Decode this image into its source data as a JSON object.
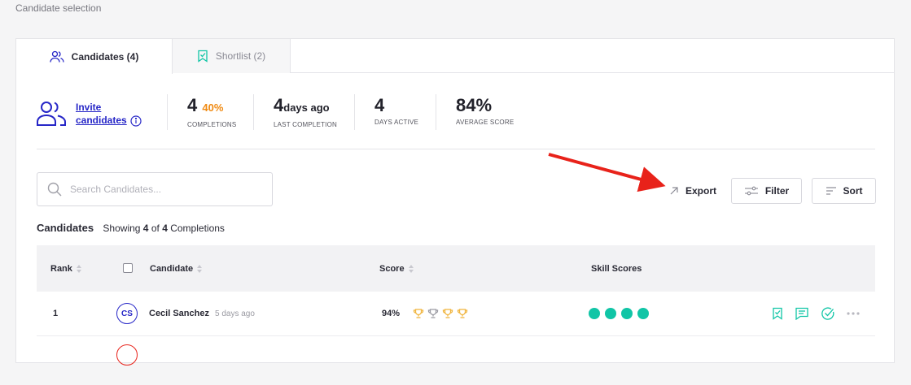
{
  "page": {
    "label": "Candidate selection"
  },
  "tabs": [
    {
      "label": "Candidates (4)",
      "icon": "users-icon",
      "active": true
    },
    {
      "label": "Shortlist (2)",
      "icon": "shortlist-icon",
      "active": false
    }
  ],
  "invite": {
    "label": "Invite candidates",
    "icon": "users-icon"
  },
  "stats": [
    {
      "value": "4",
      "suffix": "40%",
      "label": "COMPLETIONS"
    },
    {
      "value": "4",
      "suffix": "days ago",
      "label": "LAST COMPLETION"
    },
    {
      "value": "4",
      "suffix": "",
      "label": "DAYS ACTIVE"
    },
    {
      "value": "84%",
      "suffix": "",
      "label": "AVERAGE SCORE"
    }
  ],
  "search": {
    "placeholder": "Search Candidates...",
    "value": ""
  },
  "toolbar": {
    "export_label": "Export",
    "filter_label": "Filter",
    "sort_label": "Sort"
  },
  "summary": {
    "title": "Candidates",
    "showing_prefix": "Showing",
    "shown": "4",
    "of": "of",
    "total": "4",
    "suffix": "Completions"
  },
  "table": {
    "headers": {
      "rank": "Rank",
      "candidate": "Candidate",
      "score": "Score",
      "skills": "Skill Scores"
    },
    "rows": [
      {
        "rank": "1",
        "initials": "CS",
        "name": "Cecil Sanchez",
        "ago": "5 days ago",
        "score": "94%",
        "trophies": 4,
        "skill_dots": 4
      }
    ]
  },
  "colors": {
    "accent": "#2626c7",
    "orange": "#f08a12",
    "teal": "#10c5a6",
    "gold": "#f0b43c",
    "silver": "#9a9aa2",
    "annotation": "#e8221a"
  }
}
